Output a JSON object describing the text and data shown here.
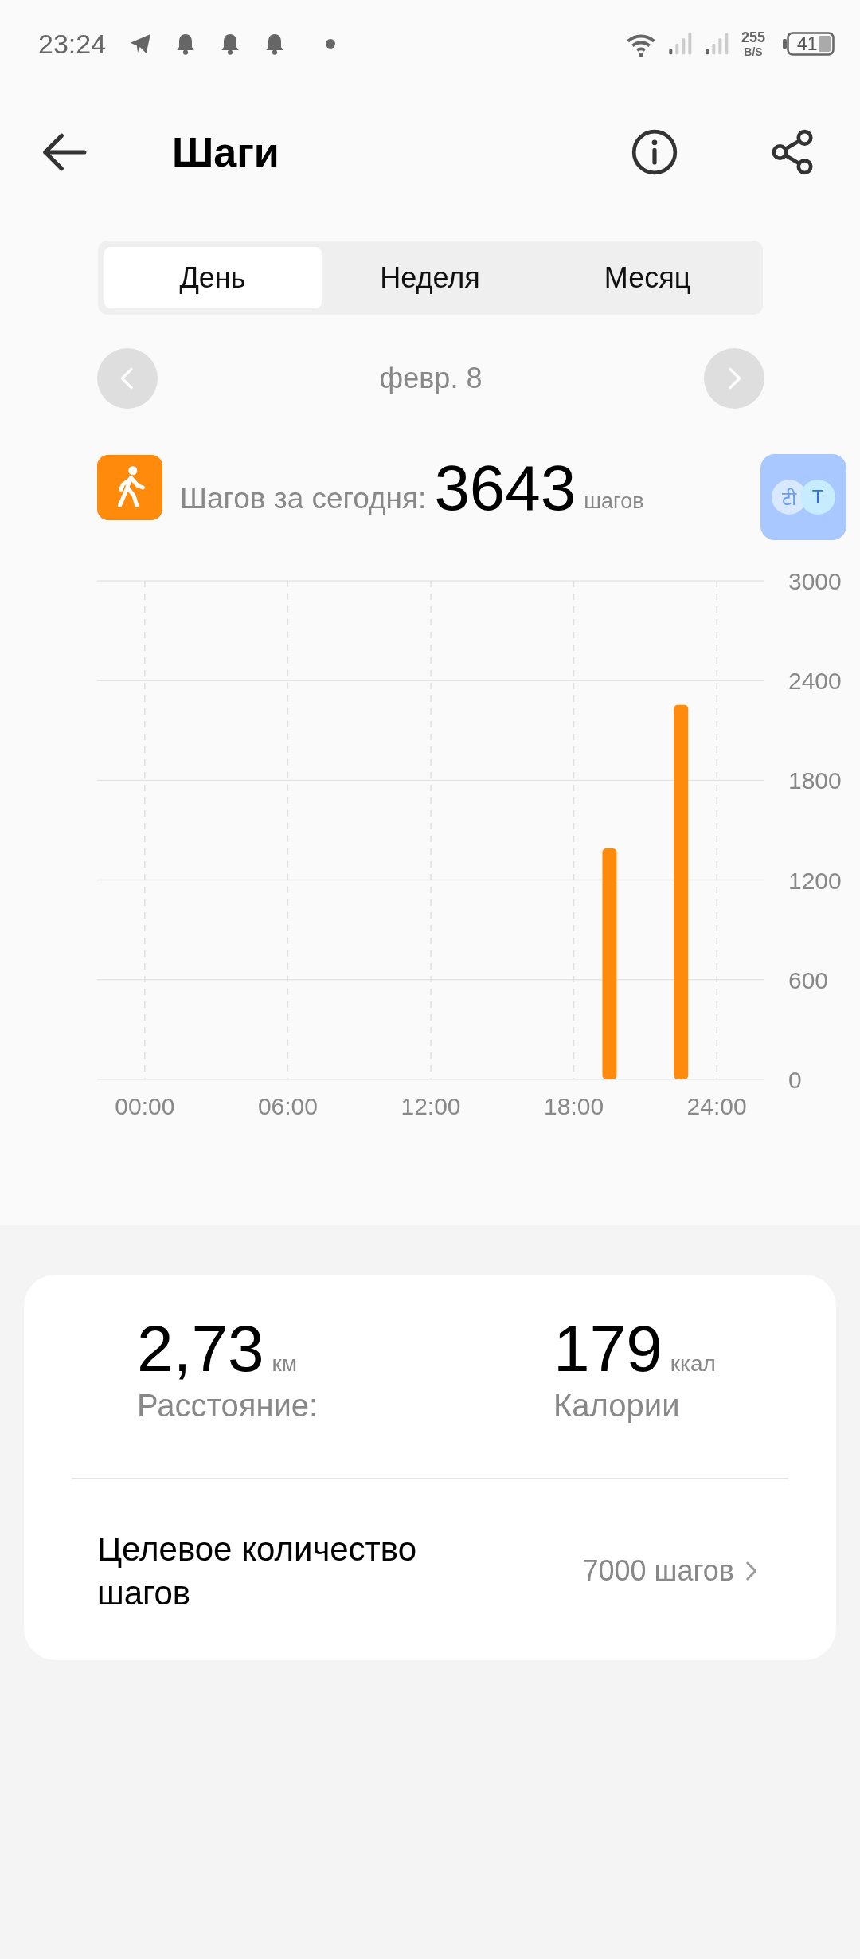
{
  "status_bar": {
    "time": "23:24",
    "notifications": [
      {
        "kind": "send"
      },
      {
        "kind": "bell"
      },
      {
        "kind": "bell"
      },
      {
        "kind": "bell"
      },
      {
        "kind": "dot"
      }
    ],
    "speed_value": "255",
    "speed_unit": "B/S",
    "battery": "41"
  },
  "header": {
    "title": "Шаги"
  },
  "tabs": [
    {
      "label": "День",
      "selected": true
    },
    {
      "label": "Неделя",
      "selected": false
    },
    {
      "label": "Месяц",
      "selected": false
    }
  ],
  "date_nav": {
    "date": "февр. 8"
  },
  "summary": {
    "label": "Шагов за сегодня:",
    "value": "3643",
    "unit": "шагов"
  },
  "chart": {
    "chart_data": {
      "type": "bar",
      "x": [
        19.5,
        22.5
      ],
      "series": [
        {
          "color": "#ff8a0c",
          "values": [
            1390,
            2253
          ]
        }
      ],
      "grid": true,
      "xlim": [
        -2,
        26
      ],
      "ylim": [
        0,
        3000
      ],
      "xticks": [
        {
          "value": 0,
          "label": "00:00"
        },
        {
          "value": 6,
          "label": "06:00"
        },
        {
          "value": 12,
          "label": "12:00"
        },
        {
          "value": 18,
          "label": "18:00"
        },
        {
          "value": 24,
          "label": "24:00"
        }
      ],
      "yticks": [
        0,
        600,
        1200,
        1800,
        2400,
        3000
      ]
    }
  },
  "stats": [
    {
      "value": "2,73",
      "unit": "км",
      "label": "Расстояние:"
    },
    {
      "value": "179",
      "unit": "ккал",
      "label": "Калории"
    }
  ],
  "goal": {
    "label": "Целевое количество шагов",
    "value": "7000 шагов"
  },
  "translate_bubble": {
    "glyphs": [
      "टी",
      "T"
    ]
  }
}
